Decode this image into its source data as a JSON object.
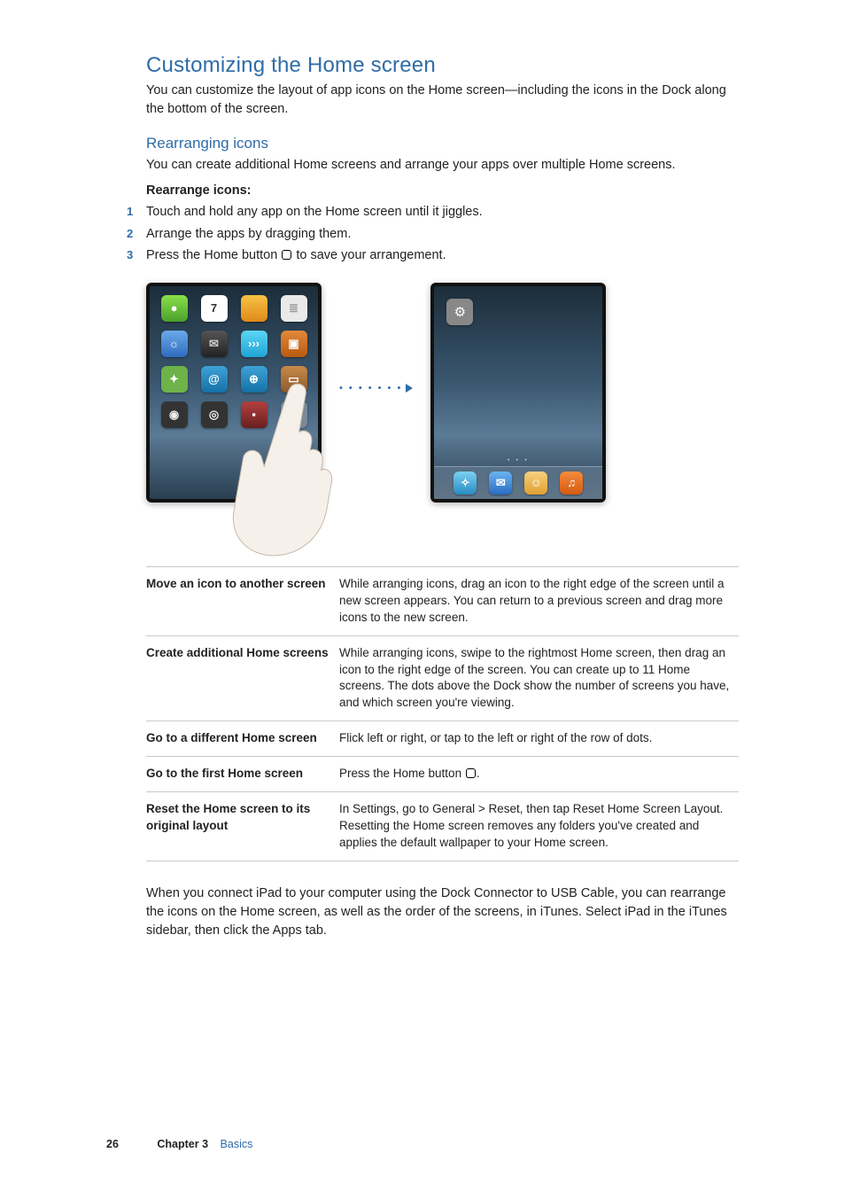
{
  "heading": "Customizing the Home screen",
  "intro": "You can customize the layout of app icons on the Home screen—including the icons in the Dock along the bottom of the screen.",
  "sub_heading": "Rearranging icons",
  "sub_intro": "You can create additional Home screens and arrange your apps over multiple Home screens.",
  "steps_title": "Rearrange icons:",
  "steps": [
    "Touch and hold any app on the Home screen until it jiggles.",
    "Arrange the apps by dragging them.",
    "Press the Home button "
  ],
  "step3_tail": " to save your arrangement.",
  "figure": {
    "screen1_icons": [
      {
        "bg": "linear-gradient(#8be04a,#4aa02c)",
        "glyph": "●"
      },
      {
        "bg": "#fff",
        "glyph": "7",
        "color": "#333"
      },
      {
        "bg": "linear-gradient(#f6c244,#e08a1a)",
        "glyph": ""
      },
      {
        "bg": "#e9e9e9",
        "glyph": "≣",
        "color": "#999"
      },
      {
        "bg": "linear-gradient(#6aa9e9,#2f6cc0)",
        "glyph": "☼"
      },
      {
        "bg": "linear-gradient(#555,#222)",
        "glyph": "✉",
        "color": "#ccc"
      },
      {
        "bg": "linear-gradient(#5bd6f5,#1fa4d4)",
        "glyph": "›››"
      },
      {
        "bg": "linear-gradient(#e38a3a,#b85912)",
        "glyph": "▣"
      },
      {
        "bg": "#6db34a",
        "glyph": "✦"
      },
      {
        "bg": "linear-gradient(#3ea2d6,#1571a6)",
        "glyph": "@"
      },
      {
        "bg": "linear-gradient(#3ea2d6,#1571a6)",
        "glyph": "⊕"
      },
      {
        "bg": "linear-gradient(#c98a4a,#8a5a2a)",
        "glyph": "▭"
      },
      {
        "bg": "#333",
        "glyph": "◉",
        "color": "#eee"
      },
      {
        "bg": "#333",
        "glyph": "◎",
        "color": "#eee"
      },
      {
        "bg": "linear-gradient(#b34040,#6a1f1f)",
        "glyph": "▪"
      },
      {
        "bg": "#7a8a9a",
        "glyph": ""
      }
    ],
    "screen2_single": {
      "glyph": "⚙"
    },
    "dock_icons": [
      {
        "bg": "linear-gradient(#7ad0f0,#2a8cc4)",
        "glyph": "✧"
      },
      {
        "bg": "linear-gradient(#6ab4f0,#2a6cc4)",
        "glyph": "✉"
      },
      {
        "bg": "linear-gradient(#f6d080,#e0a030)",
        "glyph": "☺"
      },
      {
        "bg": "linear-gradient(#f58a3a,#d45a12)",
        "glyph": "♫"
      }
    ]
  },
  "table": [
    {
      "key": "Move an icon to another screen",
      "val": "While arranging icons, drag an icon to the right edge of the screen until a new screen appears. You can return to a previous screen and drag more icons to the new screen."
    },
    {
      "key": "Create additional Home screens",
      "val": "While arranging icons, swipe to the rightmost Home screen, then drag an icon to the right edge of the screen. You can create up to 11 Home screens. The dots above the Dock show the number of screens you have, and which screen you're viewing."
    },
    {
      "key": "Go to a different Home screen",
      "val": "Flick left or right, or tap to the left or right of the row of dots."
    },
    {
      "key": "Go to the first Home screen",
      "val_prefix": "Press the Home button ",
      "val_suffix": "."
    },
    {
      "key": "Reset the Home screen to its original layout",
      "val": "In Settings, go to General > Reset, then tap Reset Home Screen Layout. Resetting the Home screen removes any folders you've created and applies the default wallpaper to your Home screen."
    }
  ],
  "closing": "When you connect iPad to your computer using the Dock Connector to USB Cable, you can rearrange the icons on the Home screen, as well as the order of the screens, in iTunes. Select iPad in the iTunes sidebar, then click the Apps tab.",
  "footer": {
    "page": "26",
    "chapter": "Chapter 3",
    "chapter_name": "Basics"
  }
}
